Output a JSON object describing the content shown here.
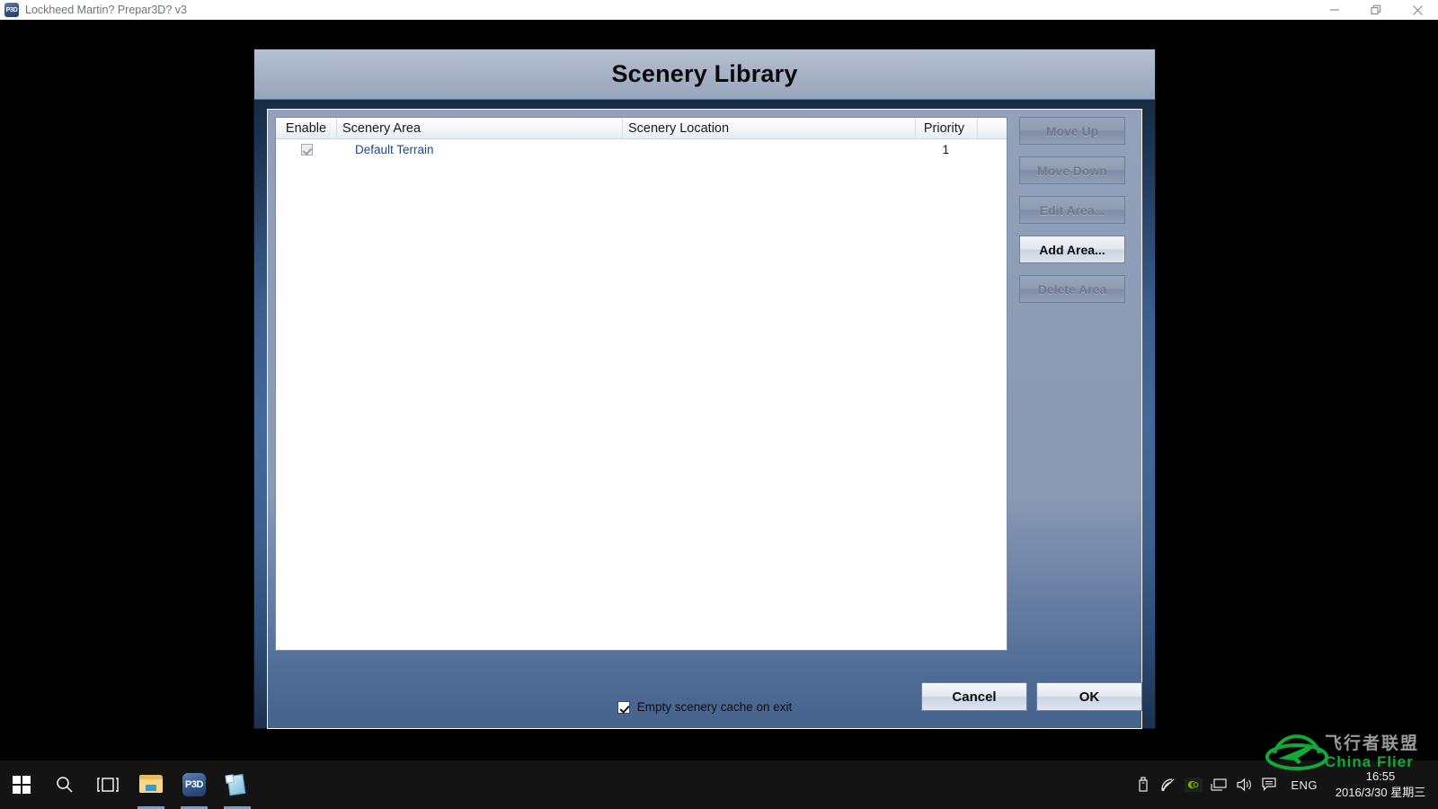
{
  "window": {
    "title": "Lockheed Martin? Prepar3D? v3",
    "app_icon": "p3d-icon",
    "icon_text": "P3D",
    "controls": {
      "minimize": "minimize-icon",
      "restore": "restore-icon",
      "close": "close-icon"
    }
  },
  "dialog": {
    "title": "Scenery Library",
    "table": {
      "columns": [
        "Enable",
        "Scenery Area",
        "Scenery Location",
        "Priority"
      ],
      "rows": [
        {
          "enabled": true,
          "area": "Default Terrain",
          "location": "",
          "priority": "1"
        }
      ]
    },
    "side_buttons": [
      {
        "label": "Move Up",
        "state": "disabled"
      },
      {
        "label": "Move Down",
        "state": "disabled"
      },
      {
        "label": "Edit Area...",
        "state": "disabled"
      },
      {
        "label": "Add Area...",
        "state": "enabled"
      },
      {
        "label": "Delete Area",
        "state": "disabled"
      }
    ],
    "cache_option": {
      "label": "Empty scenery cache on exit",
      "checked": true
    },
    "footer_buttons": {
      "cancel": "Cancel",
      "ok": "OK"
    }
  },
  "taskbar": {
    "start": "windows-logo-icon",
    "search": "search-icon",
    "task_view": "task-view-icon",
    "apps": [
      {
        "name": "file-explorer-icon"
      },
      {
        "name": "p3d-icon",
        "label": "P3D"
      },
      {
        "name": "notepad-icon"
      }
    ],
    "tray": [
      "usb-icon",
      "network-icon",
      "nvidia-icon",
      "display-icon",
      "volume-icon",
      "action-center-icon"
    ],
    "language": "ENG",
    "time": "16:55",
    "date": "2016/3/30 星期三"
  },
  "watermark": {
    "chinese": "飞行者联盟",
    "english": "China Flier",
    "color": "#14a83a"
  },
  "colors": {
    "desktop": "#000000",
    "dialog_header": "#a7b3c6",
    "panel": "#8d9cb6",
    "accent_blue": "#22478a",
    "taskbar": "#141414"
  }
}
